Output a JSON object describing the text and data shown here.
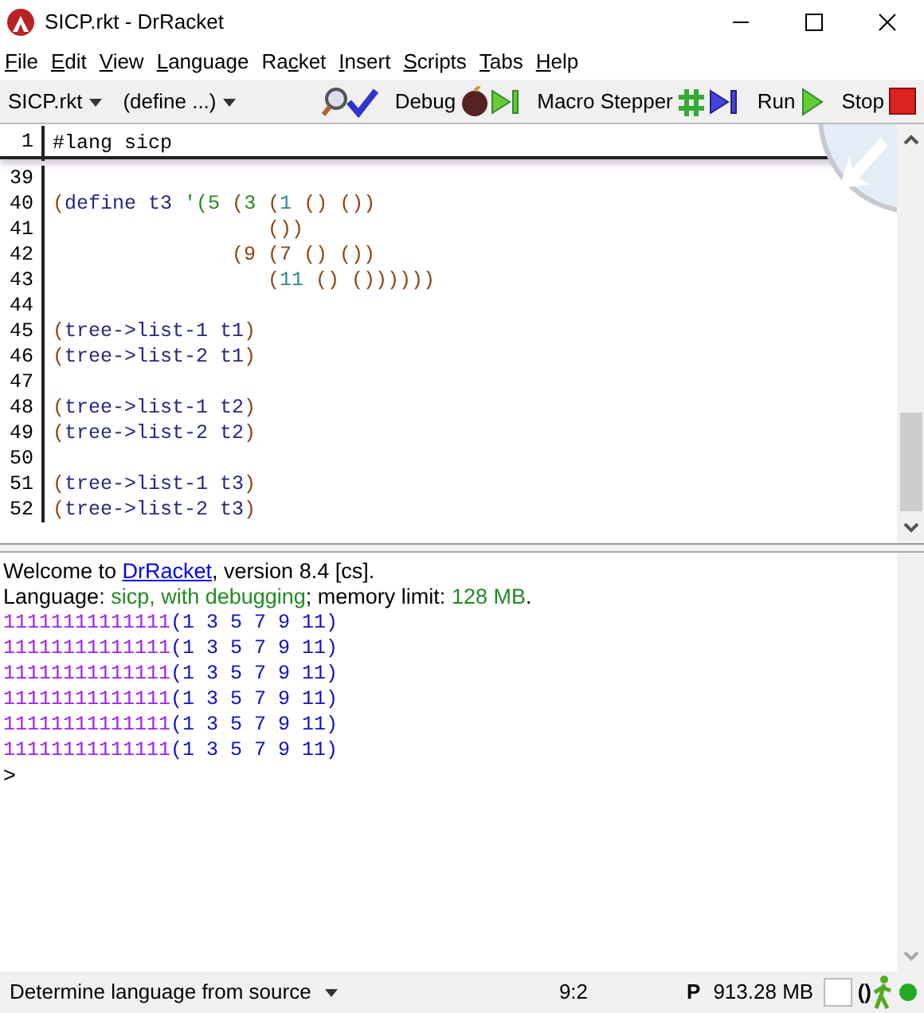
{
  "window": {
    "title": "SICP.rkt - DrRacket"
  },
  "menu": [
    {
      "key": "F",
      "after": "ile"
    },
    {
      "key": "E",
      "after": "dit"
    },
    {
      "key": "V",
      "after": "iew"
    },
    {
      "key": "L",
      "after": "anguage"
    },
    {
      "before": "Ra",
      "key": "c",
      "after": "ket"
    },
    {
      "key": "I",
      "after": "nsert"
    },
    {
      "key": "S",
      "after": "cripts"
    },
    {
      "key": "T",
      "after": "abs"
    },
    {
      "key": "H",
      "after": "elp"
    }
  ],
  "toolbar": {
    "file_menu": "SICP.rkt",
    "define_menu": "(define ...)",
    "buttons": [
      {
        "kind": "check"
      },
      {
        "kind": "debug",
        "label": "Debug"
      },
      {
        "kind": "macro",
        "label": "Macro Stepper"
      },
      {
        "kind": "run",
        "label": "Run"
      },
      {
        "kind": "stop",
        "label": "Stop"
      }
    ]
  },
  "editor": {
    "header": {
      "number": "1",
      "tokens": [
        {
          "kind": "plain",
          "text": "#lang sicp"
        }
      ]
    },
    "lines": [
      {
        "number": "39"
      },
      {
        "number": "40",
        "tokens": [
          {
            "kind": "paren",
            "text": "("
          },
          {
            "kind": "symbol",
            "text": "define t3 "
          },
          {
            "kind": "constant",
            "text": "'(5 "
          },
          {
            "kind": "paren",
            "text": "("
          },
          {
            "kind": "constant",
            "text": "3 "
          },
          {
            "kind": "paren",
            "text": "("
          },
          {
            "kind": "number",
            "text": "1"
          },
          {
            "kind": "paren",
            "text": " () ())"
          }
        ]
      },
      {
        "number": "41",
        "tokens": [
          {
            "kind": "paren",
            "text": "                  ())"
          }
        ]
      },
      {
        "number": "42",
        "tokens": [
          {
            "kind": "paren",
            "text": "               (9 (7 () ())"
          }
        ]
      },
      {
        "number": "43",
        "tokens": [
          {
            "kind": "paren",
            "text": "                  ("
          },
          {
            "kind": "number",
            "text": "11"
          },
          {
            "kind": "paren",
            "text": " () ())))))"
          }
        ]
      },
      {
        "number": "44"
      },
      {
        "number": "45",
        "tokens": [
          {
            "kind": "paren",
            "text": "("
          },
          {
            "kind": "symbol",
            "text": "tree->list-1 t1"
          },
          {
            "kind": "paren",
            "text": ")"
          }
        ]
      },
      {
        "number": "46",
        "tokens": [
          {
            "kind": "paren",
            "text": "("
          },
          {
            "kind": "symbol",
            "text": "tree->list-2 t1"
          },
          {
            "kind": "paren",
            "text": ")"
          }
        ]
      },
      {
        "number": "47"
      },
      {
        "number": "48",
        "tokens": [
          {
            "kind": "paren",
            "text": "("
          },
          {
            "kind": "symbol",
            "text": "tree->list-1 t2"
          },
          {
            "kind": "paren",
            "text": ")"
          }
        ]
      },
      {
        "number": "49",
        "tokens": [
          {
            "kind": "paren",
            "text": "("
          },
          {
            "kind": "symbol",
            "text": "tree->list-2 t2"
          },
          {
            "kind": "paren",
            "text": ")"
          }
        ]
      },
      {
        "number": "50"
      },
      {
        "number": "51",
        "tokens": [
          {
            "kind": "paren",
            "text": "("
          },
          {
            "kind": "symbol",
            "text": "tree->list-1 t3"
          },
          {
            "kind": "paren",
            "text": ")"
          }
        ]
      },
      {
        "number": "52",
        "tokens": [
          {
            "kind": "paren",
            "text": "("
          },
          {
            "kind": "symbol",
            "text": "tree->list-2 t3"
          },
          {
            "kind": "paren",
            "text": ")"
          }
        ]
      }
    ]
  },
  "repl": {
    "welcome": {
      "before": "Welcome to ",
      "link": "DrRacket",
      "after": ", version 8.4 [cs]."
    },
    "language": [
      {
        "kind": "plain",
        "text": "Language: "
      },
      {
        "kind": "setting",
        "text": "sicp, with debugging"
      },
      {
        "kind": "plain",
        "text": "; memory limit: "
      },
      {
        "kind": "setting",
        "text": "128 MB"
      },
      {
        "kind": "plain",
        "text": "."
      }
    ],
    "outputs": [
      {
        "printed": "11111111111111",
        "value": "(1 3 5 7 9 11)"
      },
      {
        "printed": "11111111111111",
        "value": "(1 3 5 7 9 11)"
      },
      {
        "printed": "11111111111111",
        "value": "(1 3 5 7 9 11)"
      },
      {
        "printed": "11111111111111",
        "value": "(1 3 5 7 9 11)"
      },
      {
        "printed": "11111111111111",
        "value": "(1 3 5 7 9 11)"
      },
      {
        "printed": "11111111111111",
        "value": "(1 3 5 7 9 11)"
      }
    ],
    "prompt": ">"
  },
  "status_bar": {
    "language": "Determine language from source",
    "position": "9:2",
    "gc_mark": "P",
    "memory": "913.28 MB",
    "parens": "()"
  }
}
